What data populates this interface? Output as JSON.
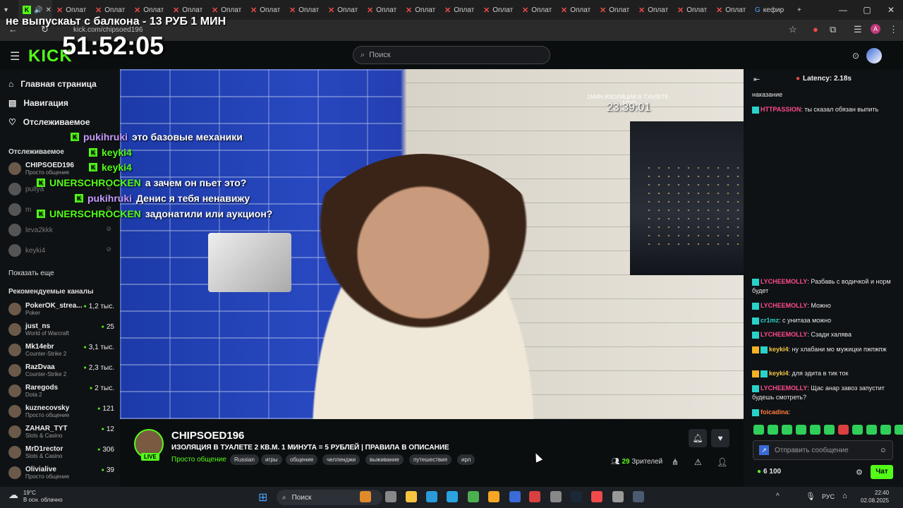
{
  "browser": {
    "tabs": [
      {
        "label": "Оплат",
        "active": false
      },
      {
        "label": "Оплат",
        "active": false
      },
      {
        "label": "Оплат",
        "active": false
      },
      {
        "label": "Оплат",
        "active": false
      },
      {
        "label": "Оплат",
        "active": false
      },
      {
        "label": "Оплат",
        "active": false
      },
      {
        "label": "Оплат",
        "active": false
      },
      {
        "label": "Оплат",
        "active": false
      },
      {
        "label": "Оплат",
        "active": false
      },
      {
        "label": "Оплат",
        "active": false
      },
      {
        "label": "Оплат",
        "active": false
      },
      {
        "label": "Оплат",
        "active": false
      },
      {
        "label": "Оплат",
        "active": false
      },
      {
        "label": "Оплат",
        "active": false
      },
      {
        "label": "Оплат",
        "active": false
      },
      {
        "label": "Оплат",
        "active": false
      },
      {
        "label": "Оплат",
        "active": false
      },
      {
        "label": "Оплат",
        "active": false
      }
    ],
    "last_tab": "кефир",
    "url": "kick.com/chipsoed196"
  },
  "overlay": {
    "banner": "не выпускаьт с балкона - 13 РУБ 1 МИН",
    "timer": "51:52:05",
    "stream_caption": "1МИН ИЗОЛЯЦИИ В ТУАЛЕТЕ - 5РУБ",
    "stream_timer": "23:39:01",
    "chat_lines": [
      {
        "user": "pukihruki",
        "text": "это базовые механики",
        "color": "purple"
      },
      {
        "user": "keyki4",
        "text": "",
        "color": "green"
      },
      {
        "user": "keyki4",
        "text": "",
        "color": "green"
      },
      {
        "user": "UNERSCHROCKEN",
        "text": "а зачем он пьет это?",
        "color": "green"
      },
      {
        "user": "pukihruki",
        "text": "Денис я тебя ненавижу",
        "color": "purple"
      },
      {
        "user": "UNERSCHROCKEN",
        "text": "задонатили или аукцион?",
        "color": "green"
      }
    ]
  },
  "header": {
    "logo": "KICK",
    "search_placeholder": "Поиск"
  },
  "sidebar": {
    "nav": [
      {
        "label": "Главная страница",
        "icon": "home-icon"
      },
      {
        "label": "Навигация",
        "icon": "compass-icon"
      },
      {
        "label": "Отслеживаемое",
        "icon": "heart-icon"
      }
    ],
    "following_title": "Отслеживаемое",
    "following": [
      {
        "name": "CHIPSOED196",
        "category": "Просто общение",
        "viewers": "",
        "online": true
      },
      {
        "name": "pullya",
        "category": "",
        "viewers": "",
        "online": false
      },
      {
        "name": "m",
        "category": "",
        "viewers": "",
        "online": false
      },
      {
        "name": "leva2kkk",
        "category": "",
        "viewers": "",
        "online": false
      },
      {
        "name": "keyki4",
        "category": "",
        "viewers": "",
        "online": false
      }
    ],
    "show_more": "Показать еще",
    "recommended_title": "Рекомендуемые каналы",
    "recommended": [
      {
        "name": "PokerOK_strea...",
        "category": "Poker",
        "viewers": "1,2 тыс."
      },
      {
        "name": "just_ns",
        "category": "World of Warcraft",
        "viewers": "25"
      },
      {
        "name": "Mk14ebr",
        "category": "Counter-Strike 2",
        "viewers": "3,1 тыс."
      },
      {
        "name": "RazDvaa",
        "category": "Counter-Strike 2",
        "viewers": "2,3 тыс."
      },
      {
        "name": "Raregods",
        "category": "Dota 2",
        "viewers": "2 тыс."
      },
      {
        "name": "kuznecovsky",
        "category": "Просто общение",
        "viewers": "121"
      },
      {
        "name": "ZAHAR_TYT",
        "category": "Slots & Casino",
        "viewers": "12"
      },
      {
        "name": "MrD1rector",
        "category": "Slots & Casino",
        "viewers": "306"
      },
      {
        "name": "Olivialive",
        "category": "Просто общение",
        "viewers": "39"
      }
    ]
  },
  "stream": {
    "streamer": "CHIPSOED196",
    "live": "LIVE",
    "title": "ИЗОЛЯЦИЯ В ТУАЛЕТЕ 2 КВ.М. 1 МИНУТА = 5 РУБЛЕЙ | ПРАВИЛА В ОПИСАНИЕ",
    "category": "Просто общение",
    "tags": [
      "Russian",
      "игры",
      "общение",
      "челленджи",
      "выживание",
      "путешествия",
      "ирл"
    ],
    "viewers_count": "29",
    "viewers_label": "Зрителей"
  },
  "chat": {
    "latency": "Latency: 2.18s",
    "messages": [
      {
        "user": "",
        "text": "наказание",
        "color": ""
      },
      {
        "user": "HTTPASSION",
        "text": ": ты сказал обязан выпить",
        "color": "pink"
      },
      {
        "user": "LYCHEEMOLLY",
        "text": ": Разбавь с водичкой и норм будет",
        "color": "pink"
      },
      {
        "user": "LYCHEEMOLLY",
        "text": ": Можно",
        "color": "pink"
      },
      {
        "user": "cr1mz",
        "text": ": с унитаза можно",
        "color": "cyan"
      },
      {
        "user": "LYCHEEMOLLY",
        "text": ": Сзади халява",
        "color": "pink"
      },
      {
        "user": "keyki4",
        "text": ": ну хлабани мо мужицки пжпжпж",
        "color": "yellow"
      },
      {
        "user": "keyki4",
        "text": ": для эдита в тик ток",
        "color": "yellow"
      },
      {
        "user": "LYCHEEMOLLY",
        "text": ": Щас анар завоз запустит будешь смотреть?",
        "color": "pink"
      },
      {
        "user": "foicadina",
        "text": ":",
        "color": "orange"
      }
    ],
    "input_placeholder": "Отправить сообщение",
    "points": "6 100",
    "send_label": "Чат"
  },
  "taskbar": {
    "weather_temp": "19°C",
    "weather_desc": "В осн. облачно",
    "search": "Поиск",
    "lang": "РУС",
    "time": "22:40",
    "date": "02.08.2025"
  },
  "colors": {
    "kick_green": "#53fc18",
    "bg": "#0b0e0f",
    "chat_pink": "#ff4a8d"
  }
}
